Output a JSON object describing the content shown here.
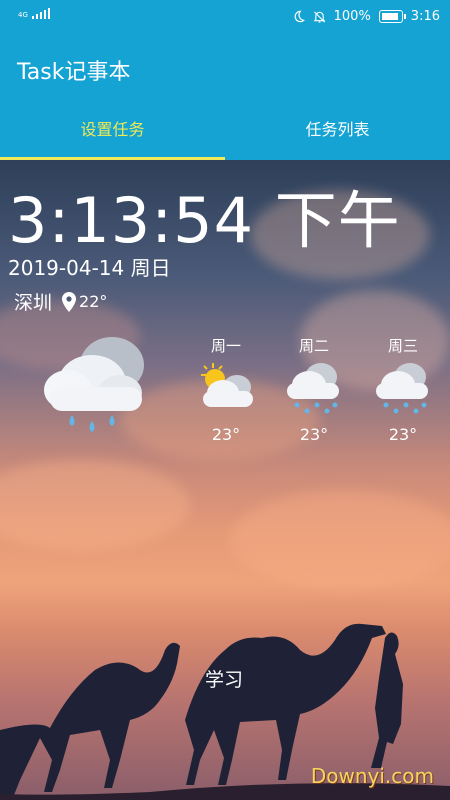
{
  "status_bar": {
    "network": "4G",
    "battery_percent": "100%",
    "battery_level": 1.0,
    "time": "3:16"
  },
  "app": {
    "title": "Task记事本"
  },
  "tabs": [
    {
      "label": "设置任务",
      "active": true
    },
    {
      "label": "任务列表",
      "active": false
    }
  ],
  "clock": {
    "time": "3:13:54 下午",
    "date": "2019-04-14  周日"
  },
  "location": {
    "city": "深圳",
    "temperature": "22°"
  },
  "current_weather": {
    "icon": "cloud-rain-icon"
  },
  "forecast": [
    {
      "day": "周一",
      "icon": "sun-cloud-icon",
      "temp": "23°"
    },
    {
      "day": "周二",
      "icon": "cloud-snow-icon",
      "temp": "23°"
    },
    {
      "day": "周三",
      "icon": "cloud-snow-icon",
      "temp": "23°"
    }
  ],
  "task": {
    "label": "学习"
  },
  "watermark": "Downyi.com",
  "colors": {
    "primary": "#14a3d2",
    "tab_active": "#f1e957",
    "watermark": "#f4d560"
  }
}
